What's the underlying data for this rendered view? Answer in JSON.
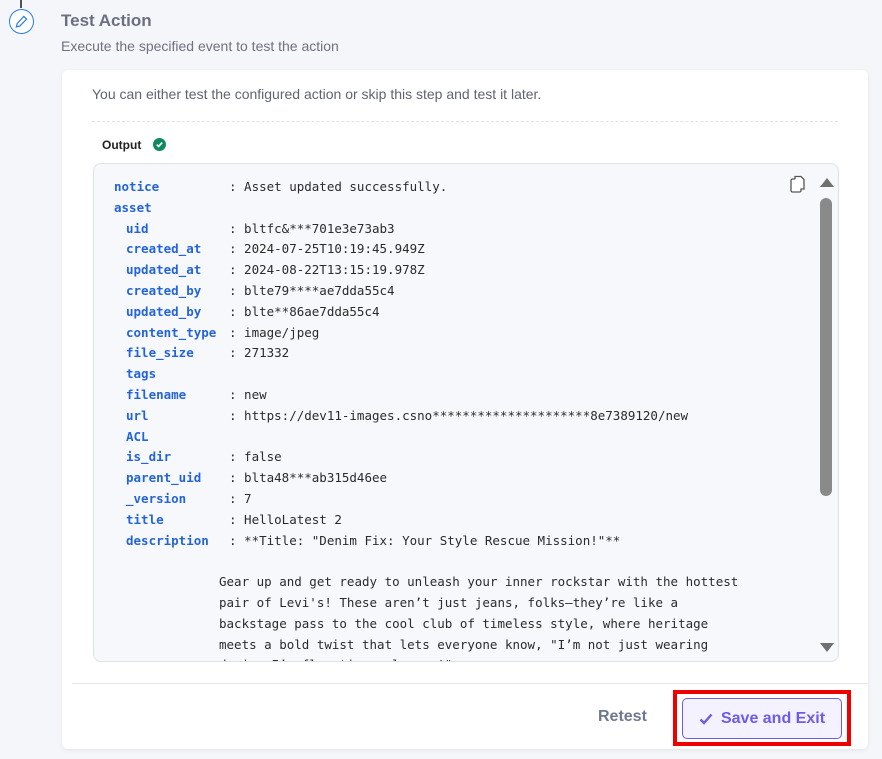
{
  "step": {
    "icon": "pencil-icon",
    "title": "Test Action",
    "subtitle": "Execute the specified event to test the action"
  },
  "card": {
    "intro": "You can either test the configured action or skip this step and test it later.",
    "output_label": "Output",
    "output_status_icon": "check-circle-icon"
  },
  "output": {
    "rows": [
      {
        "key": "notice",
        "value": ": Asset updated successfully.",
        "nested": false
      },
      {
        "key": "asset",
        "value": "",
        "nested": false
      },
      {
        "key": "uid",
        "value": ": bltfc&***701e3e73ab3",
        "nested": true
      },
      {
        "key": "created_at",
        "value": ": 2024-07-25T10:19:45.949Z",
        "nested": true
      },
      {
        "key": "updated_at",
        "value": ": 2024-08-22T13:15:19.978Z",
        "nested": true
      },
      {
        "key": "created_by",
        "value": ": blte79****ae7dda55c4",
        "nested": true
      },
      {
        "key": "updated_by",
        "value": ": blte**86ae7dda55c4",
        "nested": true
      },
      {
        "key": "content_type",
        "value": ": image/jpeg",
        "nested": true
      },
      {
        "key": "file_size",
        "value": ": 271332",
        "nested": true
      },
      {
        "key": "tags",
        "value": "",
        "nested": true
      },
      {
        "key": "filename",
        "value": ": new",
        "nested": true
      },
      {
        "key": "url",
        "value": ": https://dev11-images.csno*********************8e7389120/new",
        "nested": true
      },
      {
        "key": "ACL",
        "value": "",
        "nested": true
      },
      {
        "key": "is_dir",
        "value": ": false",
        "nested": true
      },
      {
        "key": "parent_uid",
        "value": ": blta48***ab315d46ee",
        "nested": true
      },
      {
        "key": "_version",
        "value": ": 7",
        "nested": true
      },
      {
        "key": "title",
        "value": ": HelloLatest 2",
        "nested": true
      },
      {
        "key": "description",
        "value": ": **Title: \"Denim Fix: Your Style Rescue Mission!\"**",
        "nested": true
      }
    ],
    "description_lines": [
      "",
      "Gear up and get ready to unleash your inner rockstar with the hottest",
      "pair of Levi's! These aren’t just jeans, folks—they’re like a",
      "backstage pass to the cool club of timeless style, where heritage",
      "meets a bold twist that lets everyone know, \"I’m not just wearing",
      "denim, I’m flaunting a legacy!\""
    ]
  },
  "footer": {
    "retest_label": "Retest",
    "save_label": "Save and Exit",
    "save_icon": "checkmark-icon"
  }
}
